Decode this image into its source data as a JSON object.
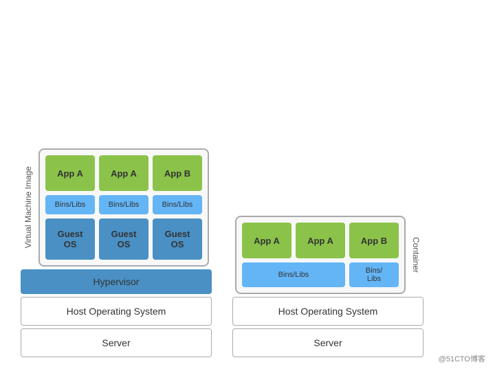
{
  "left": {
    "vm_label": "Virtual Machine Image",
    "apps": [
      "App A",
      "App A",
      "App B"
    ],
    "bins": [
      "Bins/Libs",
      "Bins/Libs",
      "Bins/Libs"
    ],
    "guests": [
      "Guest\nOS",
      "Guest\nOS",
      "Guest\nOS"
    ],
    "hypervisor": "Hypervisor",
    "host_os": "Host Operating System",
    "server": "Server"
  },
  "right": {
    "container_label": "Container",
    "apps": [
      "App A",
      "App A",
      "App B"
    ],
    "bins_wide": "Bins/Libs",
    "bins_narrow": "Bins/\nLibs",
    "host_os": "Host Operating System",
    "server": "Server"
  },
  "watermark": "@51CTO博客"
}
